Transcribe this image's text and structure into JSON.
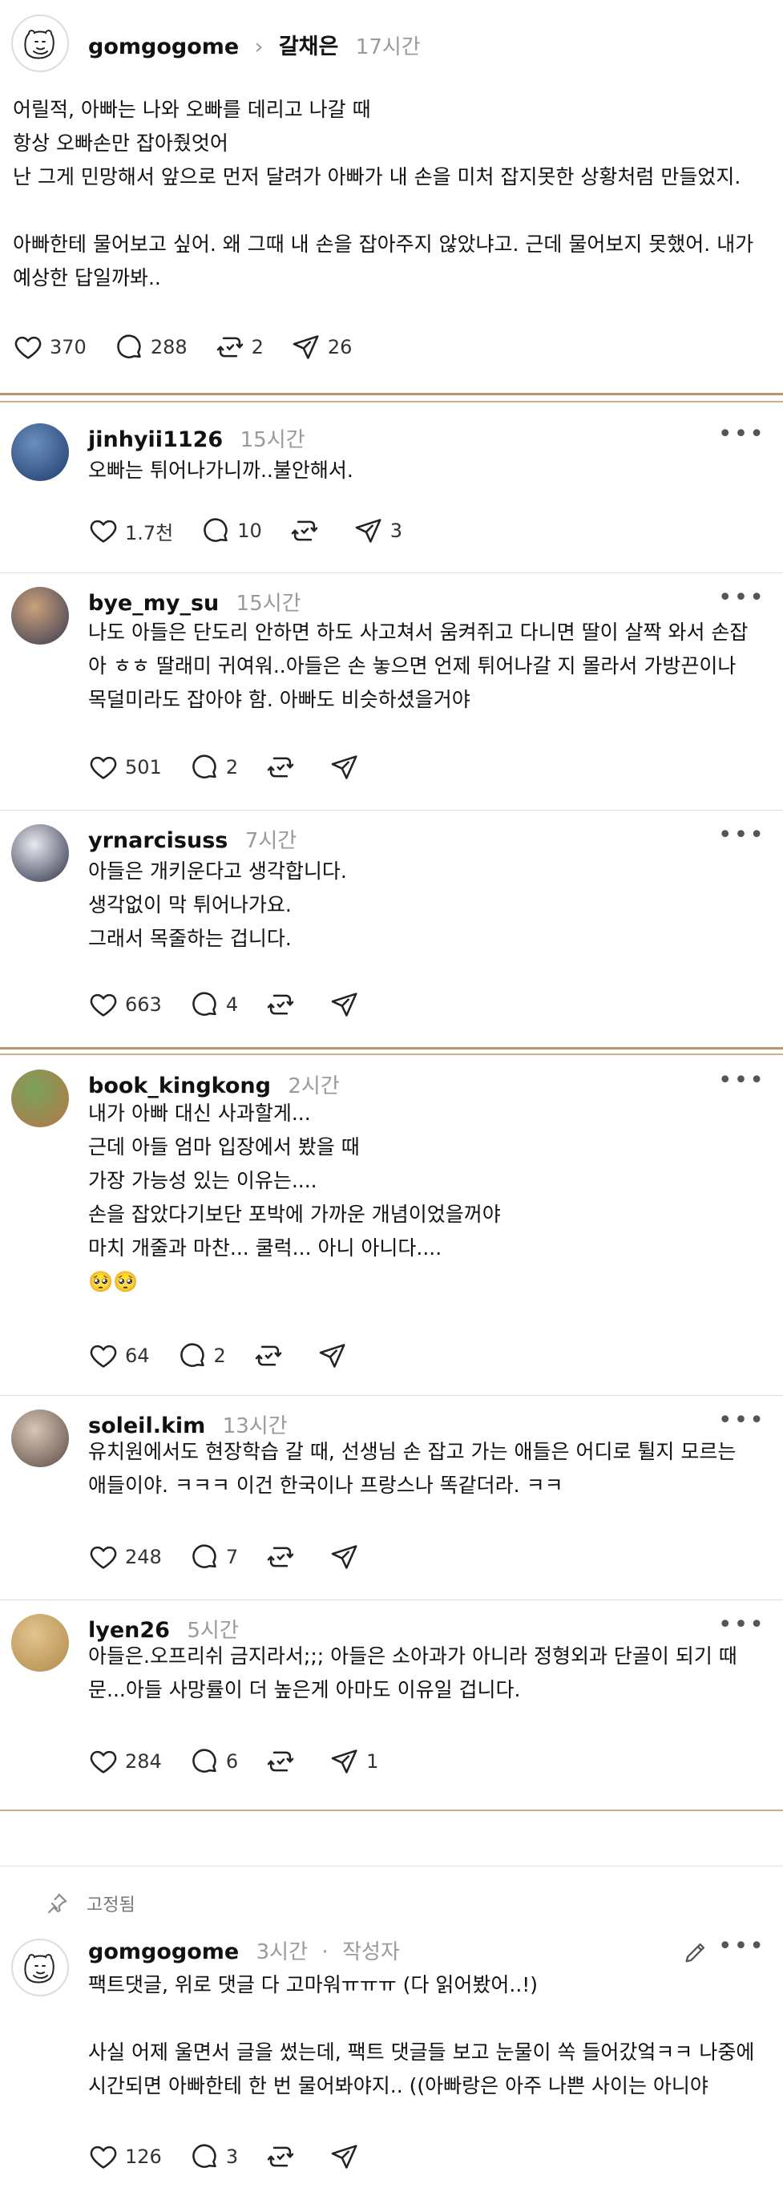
{
  "op": {
    "username": "gomgogome",
    "reply_to": "갈채은",
    "time": "17시간",
    "text": "어릴적, 아빠는 나와 오빠를 데리고 나갈 때\n항상 오빠손만 잡아줬엇어\n난 그게 민망해서 앞으로 먼저 달려가 아빠가 내 손을 미처 잡지못한 상황처럼 만들었지.\n\n아빠한테 물어보고 싶어. 왜 그때 내 손을 잡아주지 않았냐고. 근데 물어보지 못했어. 내가 예상한 답일까봐..",
    "likes": "370",
    "comments": "288",
    "reposts": "2",
    "shares": "26"
  },
  "comments": [
    {
      "username": "jinhyii1126",
      "time": "15시간",
      "text": "오빠는 튀어나가니까..불안해서.",
      "likes": "1.7천",
      "comments": "10",
      "reposts": "",
      "shares": "3"
    },
    {
      "username": "bye_my_su",
      "time": "15시간",
      "text": "나도 아들은 단도리 안하면 하도 사고쳐서 움켜쥐고 다니면 딸이 살짝 와서 손잡아 ㅎㅎ 딸래미 귀여워..아들은 손 놓으면 언제 튀어나갈 지 몰라서 가방끈이나 목덜미라도 잡아야 함. 아빠도 비슷하셨을거야",
      "likes": "501",
      "comments": "2",
      "reposts": "",
      "shares": ""
    },
    {
      "username": "yrnarcisuss",
      "time": "7시간",
      "text": "아들은 개키운다고 생각합니다.\n생각없이 막 튀어나가요.\n그래서 목줄하는 겁니다.",
      "likes": "663",
      "comments": "4",
      "reposts": "",
      "shares": ""
    },
    {
      "username": "book_kingkong",
      "time": "2시간",
      "text": "내가 아빠 대신 사과할게...\n근데 아들 엄마 입장에서 봤을 때\n가장 가능성 있는 이유는....\n손을 잡았다기보단 포박에 가까운 개념이었을꺼야\n마치 개줄과 마찬... 쿨럭... 아니 아니다....\n🥺🥺",
      "likes": "64",
      "comments": "2",
      "reposts": "",
      "shares": ""
    },
    {
      "username": "soleil.kim",
      "time": "13시간",
      "text": "유치원에서도 현장학습 갈 때, 선생님 손 잡고 가는 애들은 어디로 튈지 모르는 애들이야. ㅋㅋㅋ 이건 한국이나 프랑스나 똑같더라. ㅋㅋ",
      "likes": "248",
      "comments": "7",
      "reposts": "",
      "shares": ""
    },
    {
      "username": "lyen26",
      "time": "5시간",
      "text": "아들은.오프리쉬 금지라서;;; 아들은 소아과가 아니라 정형외과 단골이 되기 때문...아들 사망률이 더 높은게 아마도 이유일 겁니다.",
      "likes": "284",
      "comments": "6",
      "reposts": "",
      "shares": "1"
    }
  ],
  "pinned_label": "고정됨",
  "author_reply": {
    "username": "gomgogome",
    "time": "3시간",
    "author_tag": "작성자",
    "text": "팩트댓글, 위로 댓글 다 고마워ㅠㅠㅠ (다 읽어봤어..!)\n\n사실 어제 울면서 글을 썼는데, 팩트 댓글들 보고 눈물이 쏙 들어갔엌ㅋㅋ 나중에 시간되면 아빠한테 한 번 물어봐야지.. ((아빠랑은 아주 나쁜 사이는 아니야",
    "likes": "126",
    "comments": "3",
    "reposts": "",
    "shares": ""
  },
  "more_label": "•••"
}
